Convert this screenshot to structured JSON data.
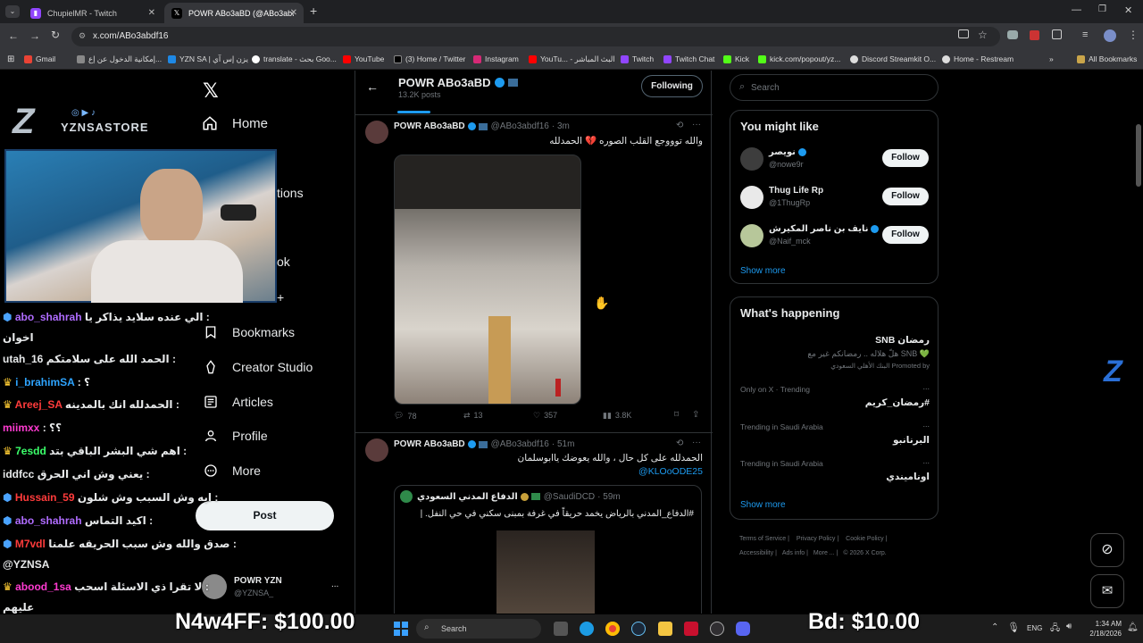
{
  "browser": {
    "tabs": [
      {
        "label": "ChupielMR - Twitch"
      },
      {
        "label": "POWR ABo3aBD (@ABo3abdf16"
      }
    ],
    "new_tab": "+",
    "url": "x.com/ABo3abdf16",
    "bookmarks": [
      {
        "label": "Gmail"
      },
      {
        "label": "إمكانية الدخول عن إع..."
      },
      {
        "label": "YZN SA | يزن إس آي"
      },
      {
        "label": "translate - بحث Goo..."
      },
      {
        "label": "YouTube"
      },
      {
        "label": "(3) Home / Twitter"
      },
      {
        "label": "Instagram"
      },
      {
        "label": "YouTu... - البث المباشر"
      },
      {
        "label": "Twitch"
      },
      {
        "label": "Twitch Chat"
      },
      {
        "label": "Kick"
      },
      {
        "label": "kick.com/popout/yz..."
      },
      {
        "label": "Discord Streamkit O..."
      },
      {
        "label": "Home - Restream"
      }
    ],
    "all_bookmarks": "All Bookmarks"
  },
  "stream": {
    "overlay_brand": "YZNSASTORE",
    "chat": [
      {
        "user": "abo_shahrah",
        "color": "#b06cff",
        "text": "الي عنده سلايد يذاكر يا :"
      },
      {
        "user": "",
        "color": "#ffffff",
        "text": "اخوان"
      },
      {
        "user": "utah_16",
        "color": "#ffffff",
        "text": "الحمد الله على سلامتكم :"
      },
      {
        "user": "i_brahimSA",
        "color": "#2ea4ff",
        "text": ": ؟"
      },
      {
        "user": "Areej_SA",
        "color": "#ff3b3b",
        "text": "الحمدلله انك بالمدينه :"
      },
      {
        "user": "miimxx",
        "color": "#ff3bd1",
        "text": ": ؟؟"
      },
      {
        "user": "7esdd",
        "color": "#3bff6a",
        "text": "اهم شي البشر الباقي بتد :"
      },
      {
        "user": "iddfcc",
        "color": "#ffffff",
        "text": "يعني وش اني الحرق :"
      },
      {
        "user": "Hussain_59",
        "color": "#ff3b3b",
        "text": "ايه وش السبب وش شلون :"
      },
      {
        "user": "abo_shahrah",
        "color": "#b06cff",
        "text": "اكيد التماس :"
      },
      {
        "user": "M7vdl",
        "color": "#ff3b3b",
        "text": "صدق والله وش سبب الحريقه علمنا :"
      },
      {
        "user": "",
        "color": "#ffffff",
        "text": "@YZNSA"
      },
      {
        "user": "abood_1sa",
        "color": "#ff3bd1",
        "text": "لا تقرا ذي الاسئلة اسحب :"
      },
      {
        "user": "",
        "color": "#ffffff",
        "text": "عليهم"
      }
    ],
    "donations": [
      {
        "label": "N4w4FF: $100.00"
      },
      {
        "label": "Bd: $10.00"
      }
    ]
  },
  "nav": {
    "items": [
      {
        "label": "Home"
      },
      {
        "label": "tions"
      },
      {
        "label": "ok"
      },
      {
        "label": "Bookmarks"
      },
      {
        "label": "Creator Studio"
      },
      {
        "label": "Articles"
      },
      {
        "label": "Profile"
      },
      {
        "label": "More"
      }
    ],
    "post_button": "Post",
    "account_name": "POWR YZN",
    "account_handle": "@YZNSA_",
    "account_more": "..."
  },
  "profile": {
    "name": "POWR ABo3aBD",
    "posts_count": "13.2K posts",
    "following_button": "Following"
  },
  "tweets": [
    {
      "name": "POWR ABo3aBD",
      "handle": "@ABo3abdf16",
      "time": "· 3m",
      "text": "والله توووجع القلب الصوره 💔 الحمدلله",
      "replies": "78",
      "retweets": "13",
      "likes": "357",
      "views": "3.8K"
    },
    {
      "name": "POWR ABo3aBD",
      "handle": "@ABo3abdf16",
      "time": "· 51m",
      "text": "الحمدلله على كل حال ، والله يعوضك ياابوسلمان",
      "mention": "@KLOoODE25",
      "quote": {
        "name": "الدفاع المدني السعودي",
        "handle": "@SaudiDCD",
        "time": "· 59m",
        "text": "#الدفاع_المدني بالرياض يخمد حريقاً في غرفة بمبنى سكني في حي النفل. |"
      }
    }
  ],
  "search": {
    "placeholder": "Search"
  },
  "might_like": {
    "title": "You might like",
    "users": [
      {
        "name": "نويصر",
        "handle": "@nowe9r",
        "button": "Follow"
      },
      {
        "name": "Thug Life Rp",
        "handle": "@1ThugRp",
        "button": "Follow"
      },
      {
        "name": "نايف بن ناصر المكيرش",
        "handle": "@Naif_mck",
        "button": "Follow"
      }
    ],
    "show_more": "Show more"
  },
  "happening": {
    "title": "What's happening",
    "promo_title": "رمضان SNB",
    "promo_text": "💚 SNB هلّ هلاله .. رمضانكم غير مع",
    "promo_by": "البنك الأهلي السعودي Promoted by",
    "trends": [
      {
        "context": "Only on X · Trending",
        "name": "#رمضان_كريم",
        "more": "..."
      },
      {
        "context": "Trending in Saudi Arabia",
        "name": "البرنانبو",
        "more": "..."
      },
      {
        "context": "Trending in Saudi Arabia",
        "name": "اوناميندي",
        "more": "..."
      }
    ],
    "show_more": "Show more"
  },
  "footer": {
    "links": [
      "Terms of Service",
      "Privacy Policy",
      "Cookie Policy",
      "Accessibility",
      "Ads info",
      "More ...",
      "© 2026 X Corp."
    ]
  },
  "taskbar": {
    "search_placeholder": "Search",
    "lang": "ENG",
    "time": "1:34 AM",
    "date": "2/18/2026"
  }
}
